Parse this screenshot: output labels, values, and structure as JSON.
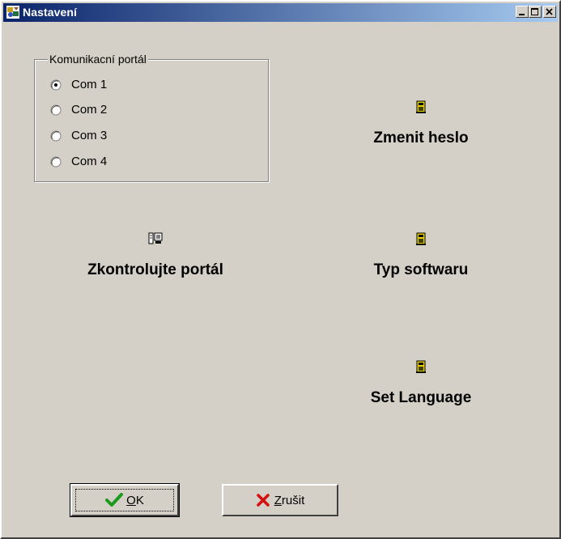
{
  "window": {
    "title": "Nastavení",
    "minimize_icon": "minimize-icon",
    "maximize_icon": "maximize-icon",
    "close_icon": "close-icon"
  },
  "port_group": {
    "legend": "Komunikacní portál",
    "options": [
      {
        "label": "Com 1",
        "selected": true
      },
      {
        "label": "Com 2",
        "selected": false
      },
      {
        "label": "Com 3",
        "selected": false
      },
      {
        "label": "Com 4",
        "selected": false
      }
    ]
  },
  "actions": {
    "change_password": "Zmenit heslo",
    "check_port": "Zkontrolujte portál",
    "software_type": "Typ softwaru",
    "set_language": "Set Language"
  },
  "buttons": {
    "ok_accel": "O",
    "ok_rest": "K",
    "cancel_accel": "Z",
    "cancel_rest": "rušit"
  },
  "colors": {
    "face": "#d4d0c8",
    "title_start": "#0a246a",
    "title_end": "#a6caf0",
    "ok_check": "#1c9a1c",
    "cancel_x": "#d41010"
  }
}
